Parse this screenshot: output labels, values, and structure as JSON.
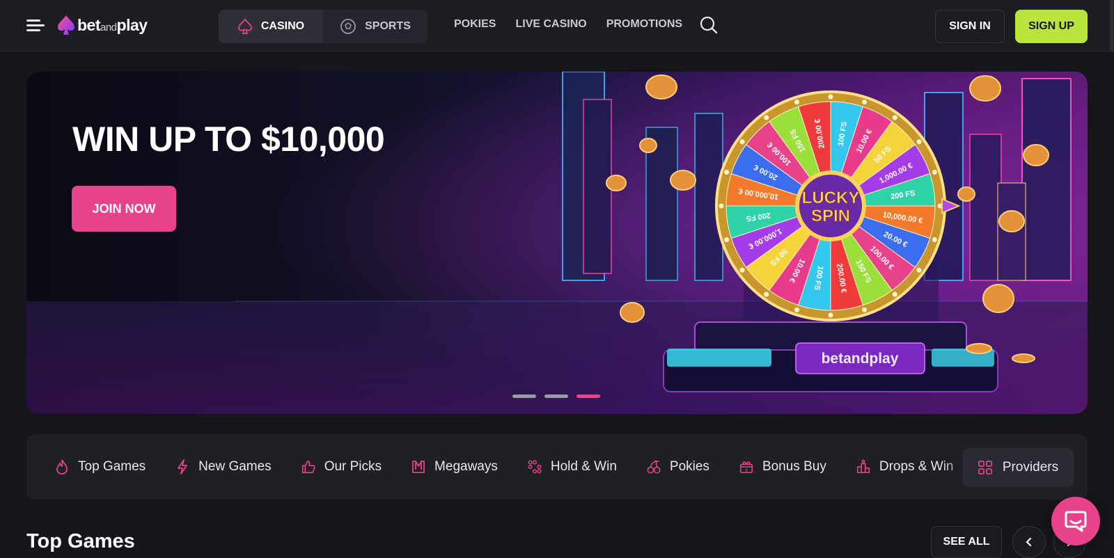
{
  "header": {
    "logo": {
      "brand_main": "bet",
      "brand_small": "and",
      "brand_end": "play"
    },
    "mode_tabs": [
      {
        "label": "CASINO",
        "icon": "spade-icon",
        "active": true
      },
      {
        "label": "SPORTS",
        "icon": "soccer-ball-icon",
        "active": false
      }
    ],
    "nav": [
      "POKIES",
      "LIVE CASINO",
      "PROMOTIONS"
    ],
    "sign_in_label": "SIGN IN",
    "sign_up_label": "SIGN UP"
  },
  "hero": {
    "title": "WIN UP TO $10,000",
    "cta_label": "JOIN NOW",
    "wheel_center_top": "LUCKY",
    "wheel_center_bottom": "SPIN",
    "wheel_segments": [
      "100 FS",
      "10.00 €",
      "50 FS",
      "1,000.00 €",
      "200 FS",
      "10,000.00 €",
      "20.00 €",
      "100.00 €",
      "150 FS",
      "200.00 €",
      "100 FS",
      "10.00 €",
      "50 FS",
      "1,000.00 €",
      "200 FS",
      "10,000.00 €",
      "20.00 €",
      "100.00 €",
      "150 FS",
      "200.00 €"
    ],
    "machine_logo": "betandplay",
    "slide_count": 3,
    "active_slide": 3
  },
  "categories": [
    {
      "label": "Top Games",
      "icon": "flame-icon"
    },
    {
      "label": "New Games",
      "icon": "lightning-icon"
    },
    {
      "label": "Our Picks",
      "icon": "thumbs-up-icon"
    },
    {
      "label": "Megaways",
      "icon": "megaways-icon"
    },
    {
      "label": "Hold & Win",
      "icon": "dots-grid-icon"
    },
    {
      "label": "Pokies",
      "icon": "cherries-icon"
    },
    {
      "label": "Bonus Buy",
      "icon": "gift-icon"
    },
    {
      "label": "Drops & Win",
      "icon": "podium-icon"
    }
  ],
  "providers_label": "Providers",
  "top_games": {
    "title": "Top Games",
    "see_all_label": "SEE ALL"
  },
  "colors": {
    "accent_pink": "#e8428a",
    "signup_green": "#b9e33d",
    "background": "#15151b"
  }
}
